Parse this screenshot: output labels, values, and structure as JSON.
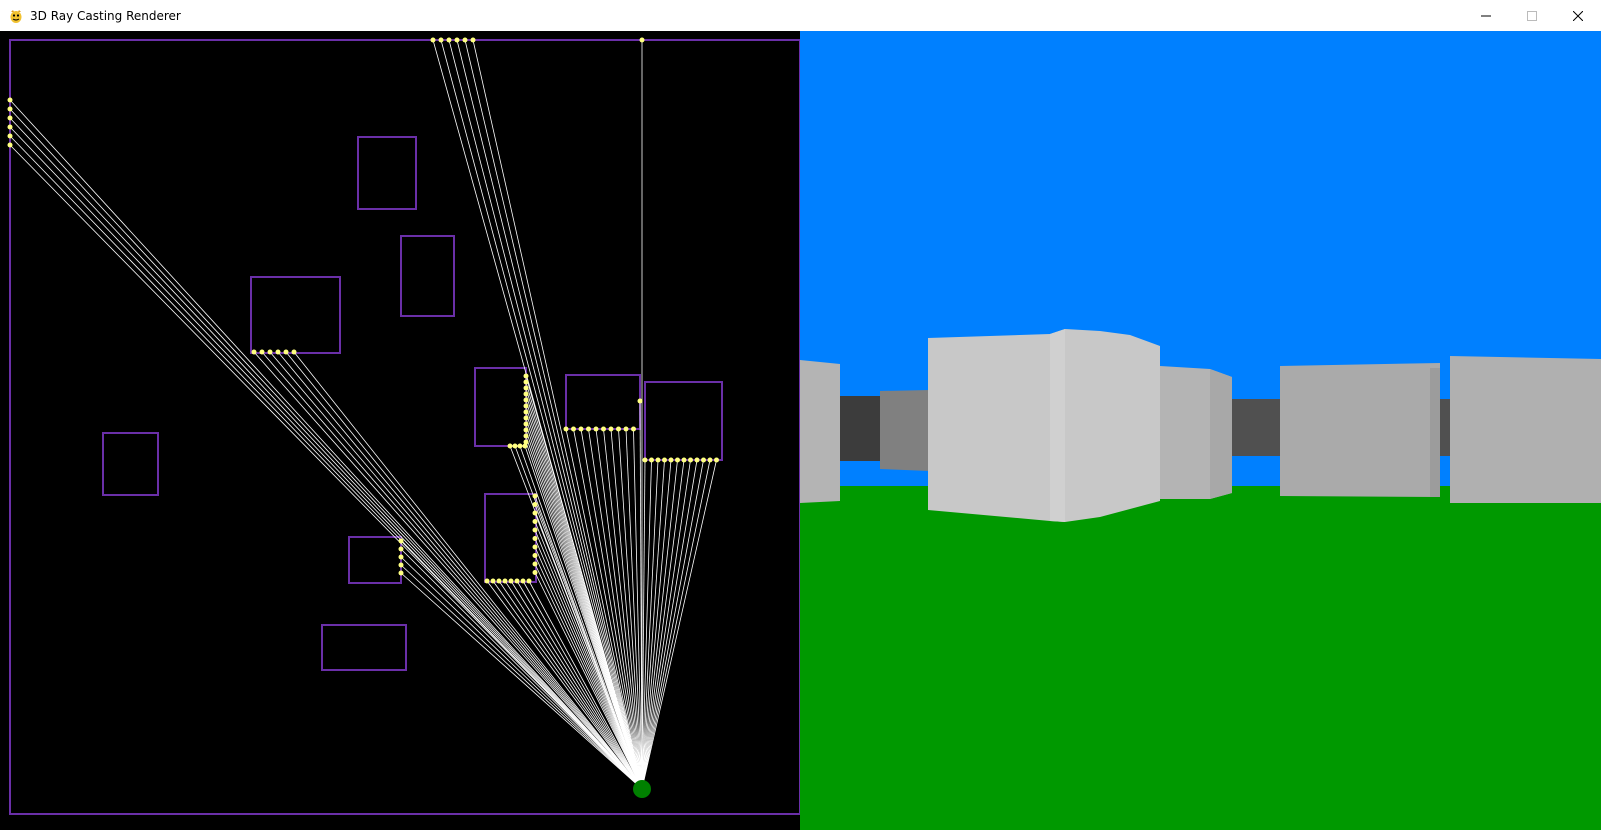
{
  "window": {
    "title": "3D Ray Casting Renderer",
    "app_icon": "pygame-snake-icon",
    "controls": [
      "minimize-icon",
      "maximize-icon",
      "close-icon"
    ]
  },
  "colors": {
    "map_background": "#000000",
    "wall_outline": "#6a2fa8",
    "ray": "#ffffff",
    "hit_point": "#ffff80",
    "player": "#008000",
    "sky": "#0080ff",
    "ground": "#009900"
  }
}
